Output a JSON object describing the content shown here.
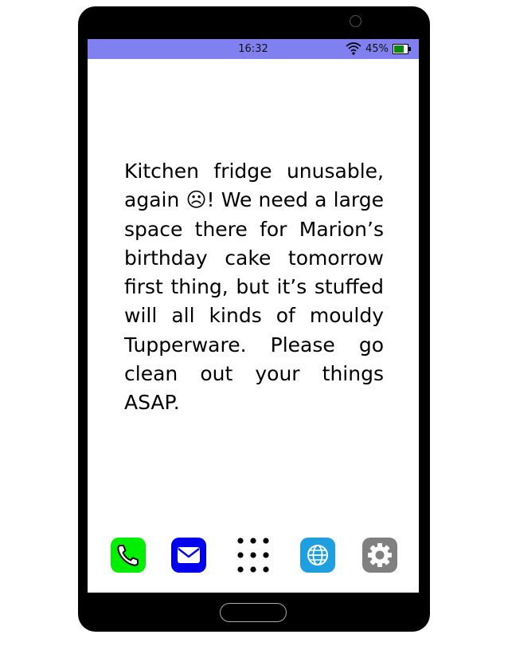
{
  "status_bar": {
    "time": "16:32",
    "battery_percent_label": "45%",
    "battery_level": 0.45,
    "wifi_icon": "wifi-icon",
    "background_color": "#8080f0"
  },
  "message": {
    "text": "Kitchen fridge unusable, again ☹! We need a large space there for Marion’s birthday cake tomorrow first thing, but it’s stuffed will all kinds of mouldy Tupperware.  Please go clean out your things ASAP."
  },
  "dock": {
    "apps": [
      {
        "name": "phone",
        "icon": "phone-icon",
        "color": "#00ee00"
      },
      {
        "name": "mail",
        "icon": "mail-icon",
        "color": "#0000ee"
      },
      {
        "name": "app-drawer",
        "icon": "app-grid-icon",
        "color": "#000000"
      },
      {
        "name": "browser",
        "icon": "globe-icon",
        "color": "#1e9fe0"
      },
      {
        "name": "settings",
        "icon": "gear-icon",
        "color": "#808080"
      }
    ]
  }
}
